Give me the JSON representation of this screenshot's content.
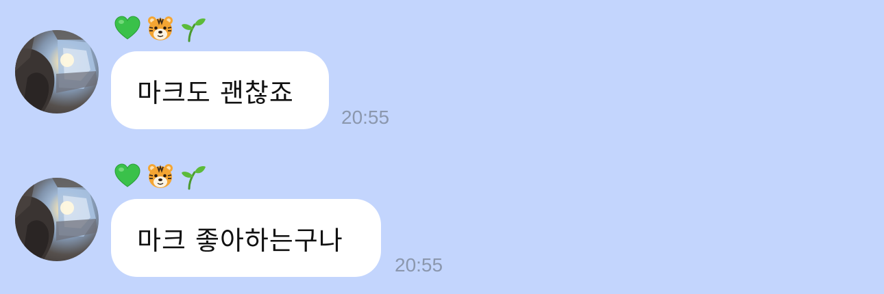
{
  "chat": {
    "background": "#c3d5fd",
    "messages": [
      {
        "sender_emojis": [
          "green-heart",
          "tiger-face",
          "seedling"
        ],
        "text": "마크도 괜찮죠",
        "time": "20:55"
      },
      {
        "sender_emojis": [
          "green-heart",
          "tiger-face",
          "seedling"
        ],
        "text": "마크 좋아하는구나",
        "time": "20:55"
      }
    ]
  }
}
